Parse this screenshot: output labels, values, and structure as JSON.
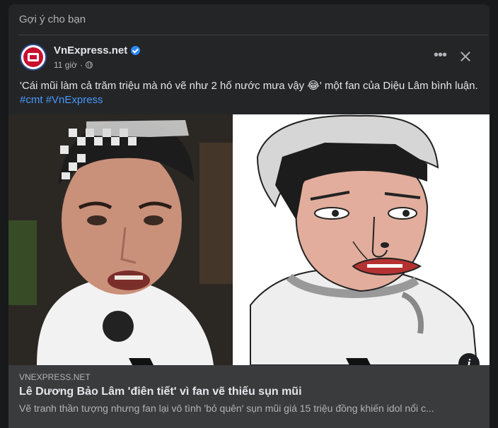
{
  "section_header": "Gợi ý cho bạn",
  "post": {
    "page_name": "VnExpress.net",
    "timestamp": "11 giờ",
    "separator": "·",
    "audience_icon": "globe-icon",
    "text": "'Cái mũi làm cả trăm triệu mà nó vẽ như 2 hố nước mưa vậy 😂' một fan của Diệu Lâm bình luận.",
    "hashtags": [
      "#cmt",
      "#VnExpress"
    ],
    "more_icon": "more-dots-icon",
    "close_icon": "close-icon"
  },
  "media": {
    "left_image": "photo of man wearing checkered bandana and sunglasses",
    "right_image": "fan drawing of the man",
    "info_icon": "i"
  },
  "link_preview": {
    "domain": "VNEXPRESS.NET",
    "title": "Lê Dương Bảo Lâm 'điên tiết' vì fan vẽ thiếu sụn mũi",
    "description": "Vẽ tranh thần tượng nhưng fan lại vô tình 'bỏ quên' sụn mũi giá 15 triệu đồng khiến idol nổi c..."
  },
  "colors": {
    "background": "#18191a",
    "card": "#242526",
    "link_preview_bg": "#3a3b3c",
    "primary_text": "#e4e6eb",
    "secondary_text": "#b0b3b8",
    "hashtag": "#4599ff",
    "verified": "#2d88ff",
    "brand": "#c8102e"
  }
}
